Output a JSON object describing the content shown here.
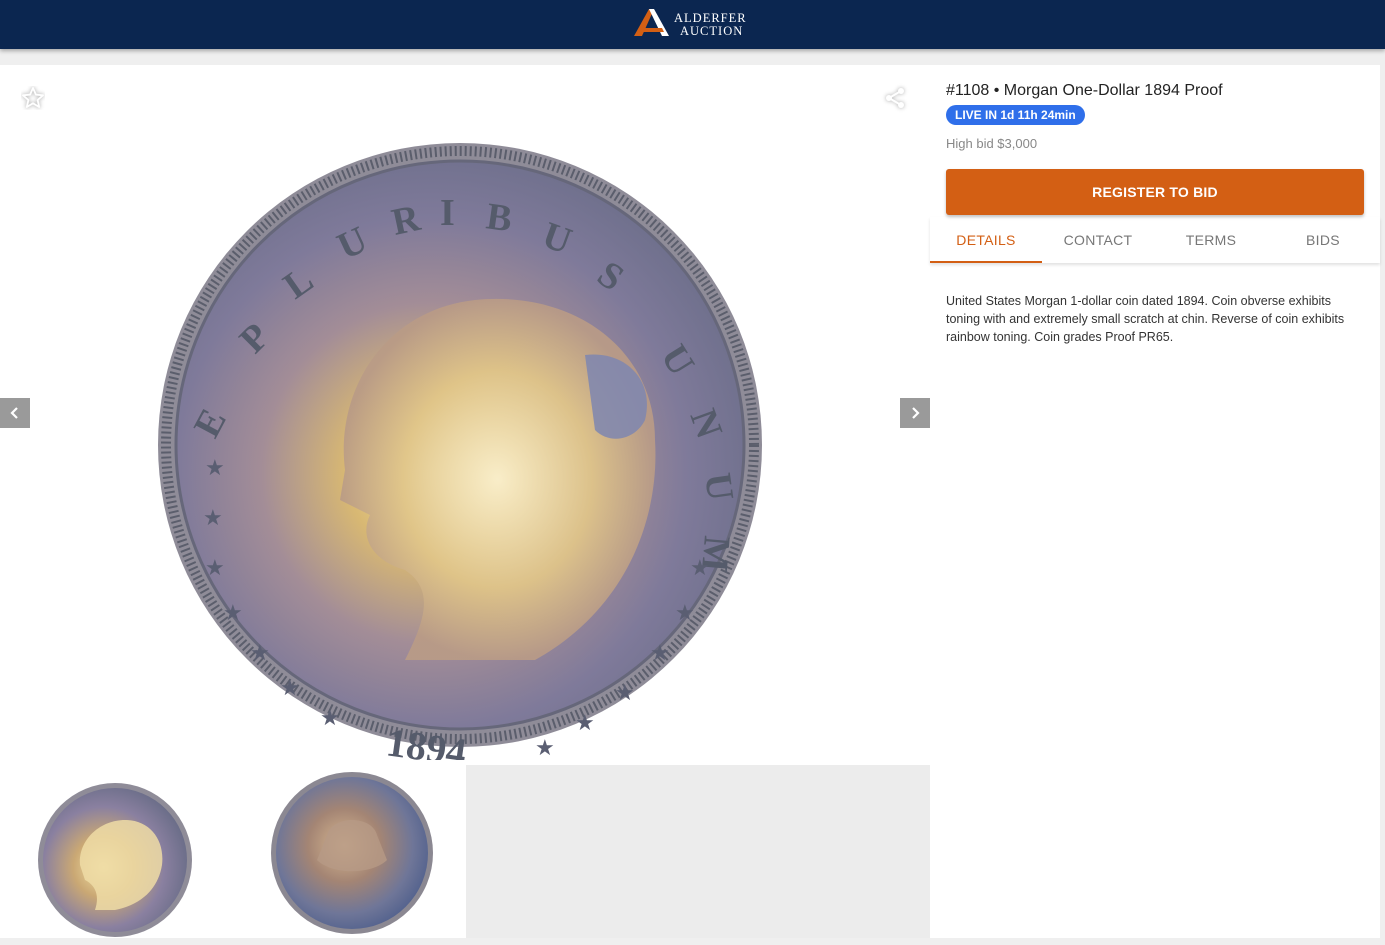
{
  "header": {
    "brand_line1": "ALDERFER",
    "brand_line2": "AUCTION",
    "brand_color": "#0b2650",
    "accent_color": "#d35f14"
  },
  "gallery": {
    "favorite_icon": "star-outline-icon",
    "share_icon": "share-icon",
    "prev_icon": "chevron-left-icon",
    "next_icon": "chevron-right-icon",
    "main_image": "coin-obverse-1894",
    "thumbnails": [
      "coin-obverse-1894",
      "coin-reverse"
    ]
  },
  "lot": {
    "title": "#1108 • Morgan One-Dollar 1894 Proof",
    "live_badge": "LIVE IN 1d 11h 24min",
    "live_badge_color": "#2f6fea",
    "high_bid": "High bid $3,000",
    "register_label": "REGISTER TO BID",
    "tabs": [
      {
        "label": "DETAILS",
        "active": true
      },
      {
        "label": "CONTACT",
        "active": false
      },
      {
        "label": "TERMS",
        "active": false
      },
      {
        "label": "BIDS",
        "active": false
      }
    ],
    "description": "United States Morgan 1-dollar coin dated 1894. Coin obverse exhibits toning with and extremely small scratch at chin. Reverse of coin exhibits rainbow toning. Coin grades Proof PR65."
  }
}
